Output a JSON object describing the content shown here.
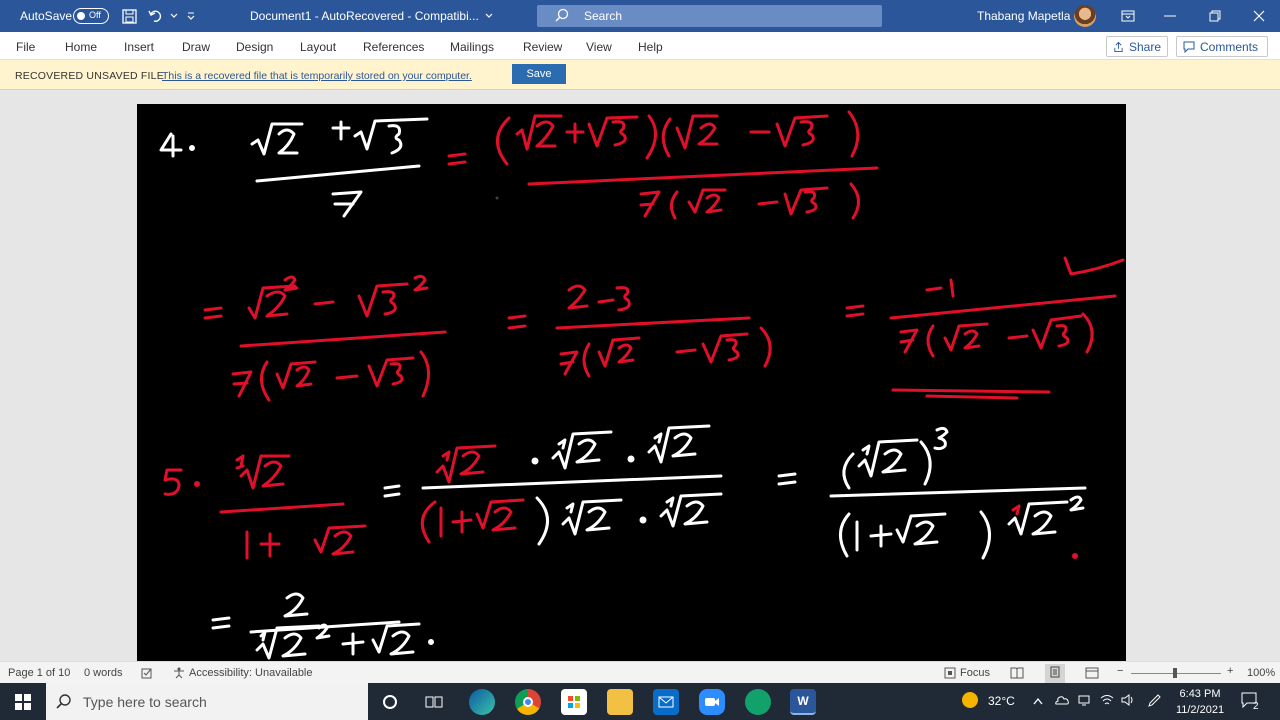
{
  "titlebar": {
    "autosave_label": "AutoSave",
    "autosave_state": "Off",
    "document_title": "Document1  -  AutoRecovered  -  Compatibi...",
    "search_placeholder": "Search",
    "user_name": "Thabang Mapetla"
  },
  "ribbon": {
    "tabs": [
      "File",
      "Home",
      "Insert",
      "Draw",
      "Design",
      "Layout",
      "References",
      "Mailings",
      "Review",
      "View",
      "Help"
    ],
    "share_label": "Share",
    "comments_label": "Comments"
  },
  "infobar": {
    "heading": "RECOVERED UNSAVED FILE",
    "message": "This is a recovered file that is temporarily stored on your computer.",
    "save_label": "Save"
  },
  "document": {
    "handwriting": {
      "ink_white": "#ffffff",
      "ink_red": "#e0102a",
      "problem4_number": "4.",
      "problem5_number": "5."
    }
  },
  "statusbar": {
    "page_info": "Page 1 of 10",
    "word_count": "0 words",
    "accessibility": "Accessibility: Unavailable",
    "focus_label": "Focus",
    "zoom": "100%"
  },
  "taskbar": {
    "search_placeholder": "Type here to search",
    "temperature": "32°C",
    "time": "6:43 PM",
    "date": "11/2/2021",
    "notification_count": "2"
  },
  "colors": {
    "word_blue": "#2b579a",
    "infobar_yellow": "#fff4ce",
    "taskbar": "#1f2a36"
  }
}
